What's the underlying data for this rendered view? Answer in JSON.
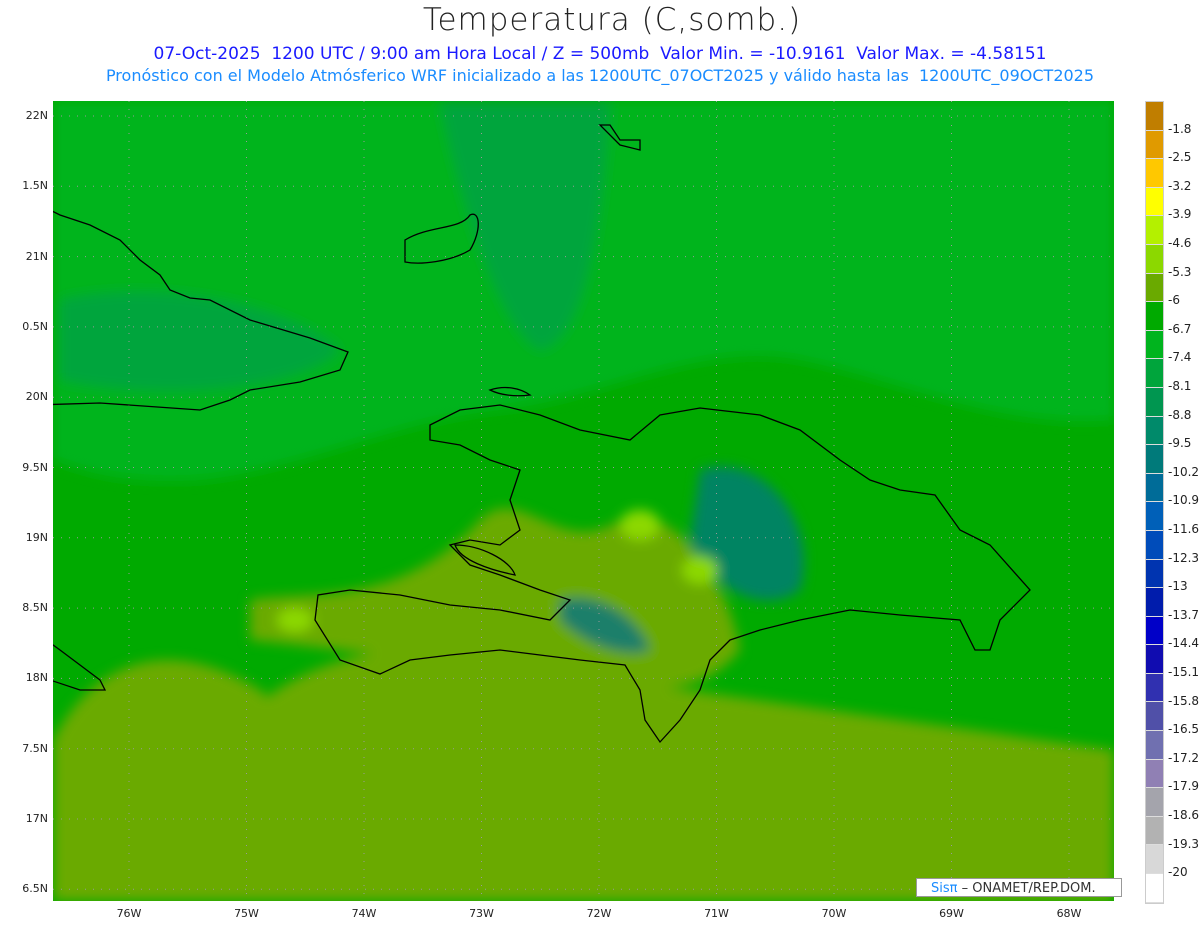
{
  "header": {
    "title": "Temperatura (C,somb.)",
    "line1": "07-Oct-2025  1200 UTC / 9:00 am Hora Local / Z = 500mb  Valor Min. = -10.9161  Valor Max. = -4.58151",
    "line2": "Pronóstico con el Modelo Atmósferico WRF inicializado a las 1200UTC_07OCT2025 y válido hasta las  1200UTC_09OCT2025"
  },
  "axes": {
    "lat_labels": [
      "22N",
      "1.5N",
      "21N",
      "0.5N",
      "20N",
      "9.5N",
      "19N",
      "8.5N",
      "18N",
      "7.5N",
      "17N",
      "6.5N"
    ],
    "lon_labels": [
      "76W",
      "75W",
      "74W",
      "73W",
      "72W",
      "71W",
      "70W",
      "69W",
      "68W"
    ]
  },
  "colorbar": {
    "colors": [
      "#c07e00",
      "#e09a00",
      "#ffc800",
      "#ffff00",
      "#b4f000",
      "#8cd800",
      "#6aaa00",
      "#00aa00",
      "#00b41e",
      "#00a53c",
      "#009650",
      "#008a6a",
      "#007a7a",
      "#006c98",
      "#0060b8",
      "#004cba",
      "#0034b0",
      "#001cac",
      "#0000c8",
      "#100cb0",
      "#3030b0",
      "#5050a8",
      "#7070b0",
      "#9080b4",
      "#a4a4ac",
      "#b2b2b2",
      "#d8d8d8",
      "#ffffff"
    ],
    "labels": [
      "-1.8",
      "-2.5",
      "-3.2",
      "-3.9",
      "-4.6",
      "-5.3",
      "-6",
      "-6.7",
      "-7.4",
      "-8.1",
      "-8.8",
      "-9.5",
      "-10.2",
      "-10.9",
      "-11.6",
      "-12.3",
      "-13",
      "-13.7",
      "-14.4",
      "-15.1",
      "-15.8",
      "-16.5",
      "-17.2",
      "-17.9",
      "-18.6",
      "-19.3",
      "-20"
    ]
  },
  "credit": {
    "sis": "Sisπ",
    "rest": " – ONAMET/REP.DOM."
  }
}
